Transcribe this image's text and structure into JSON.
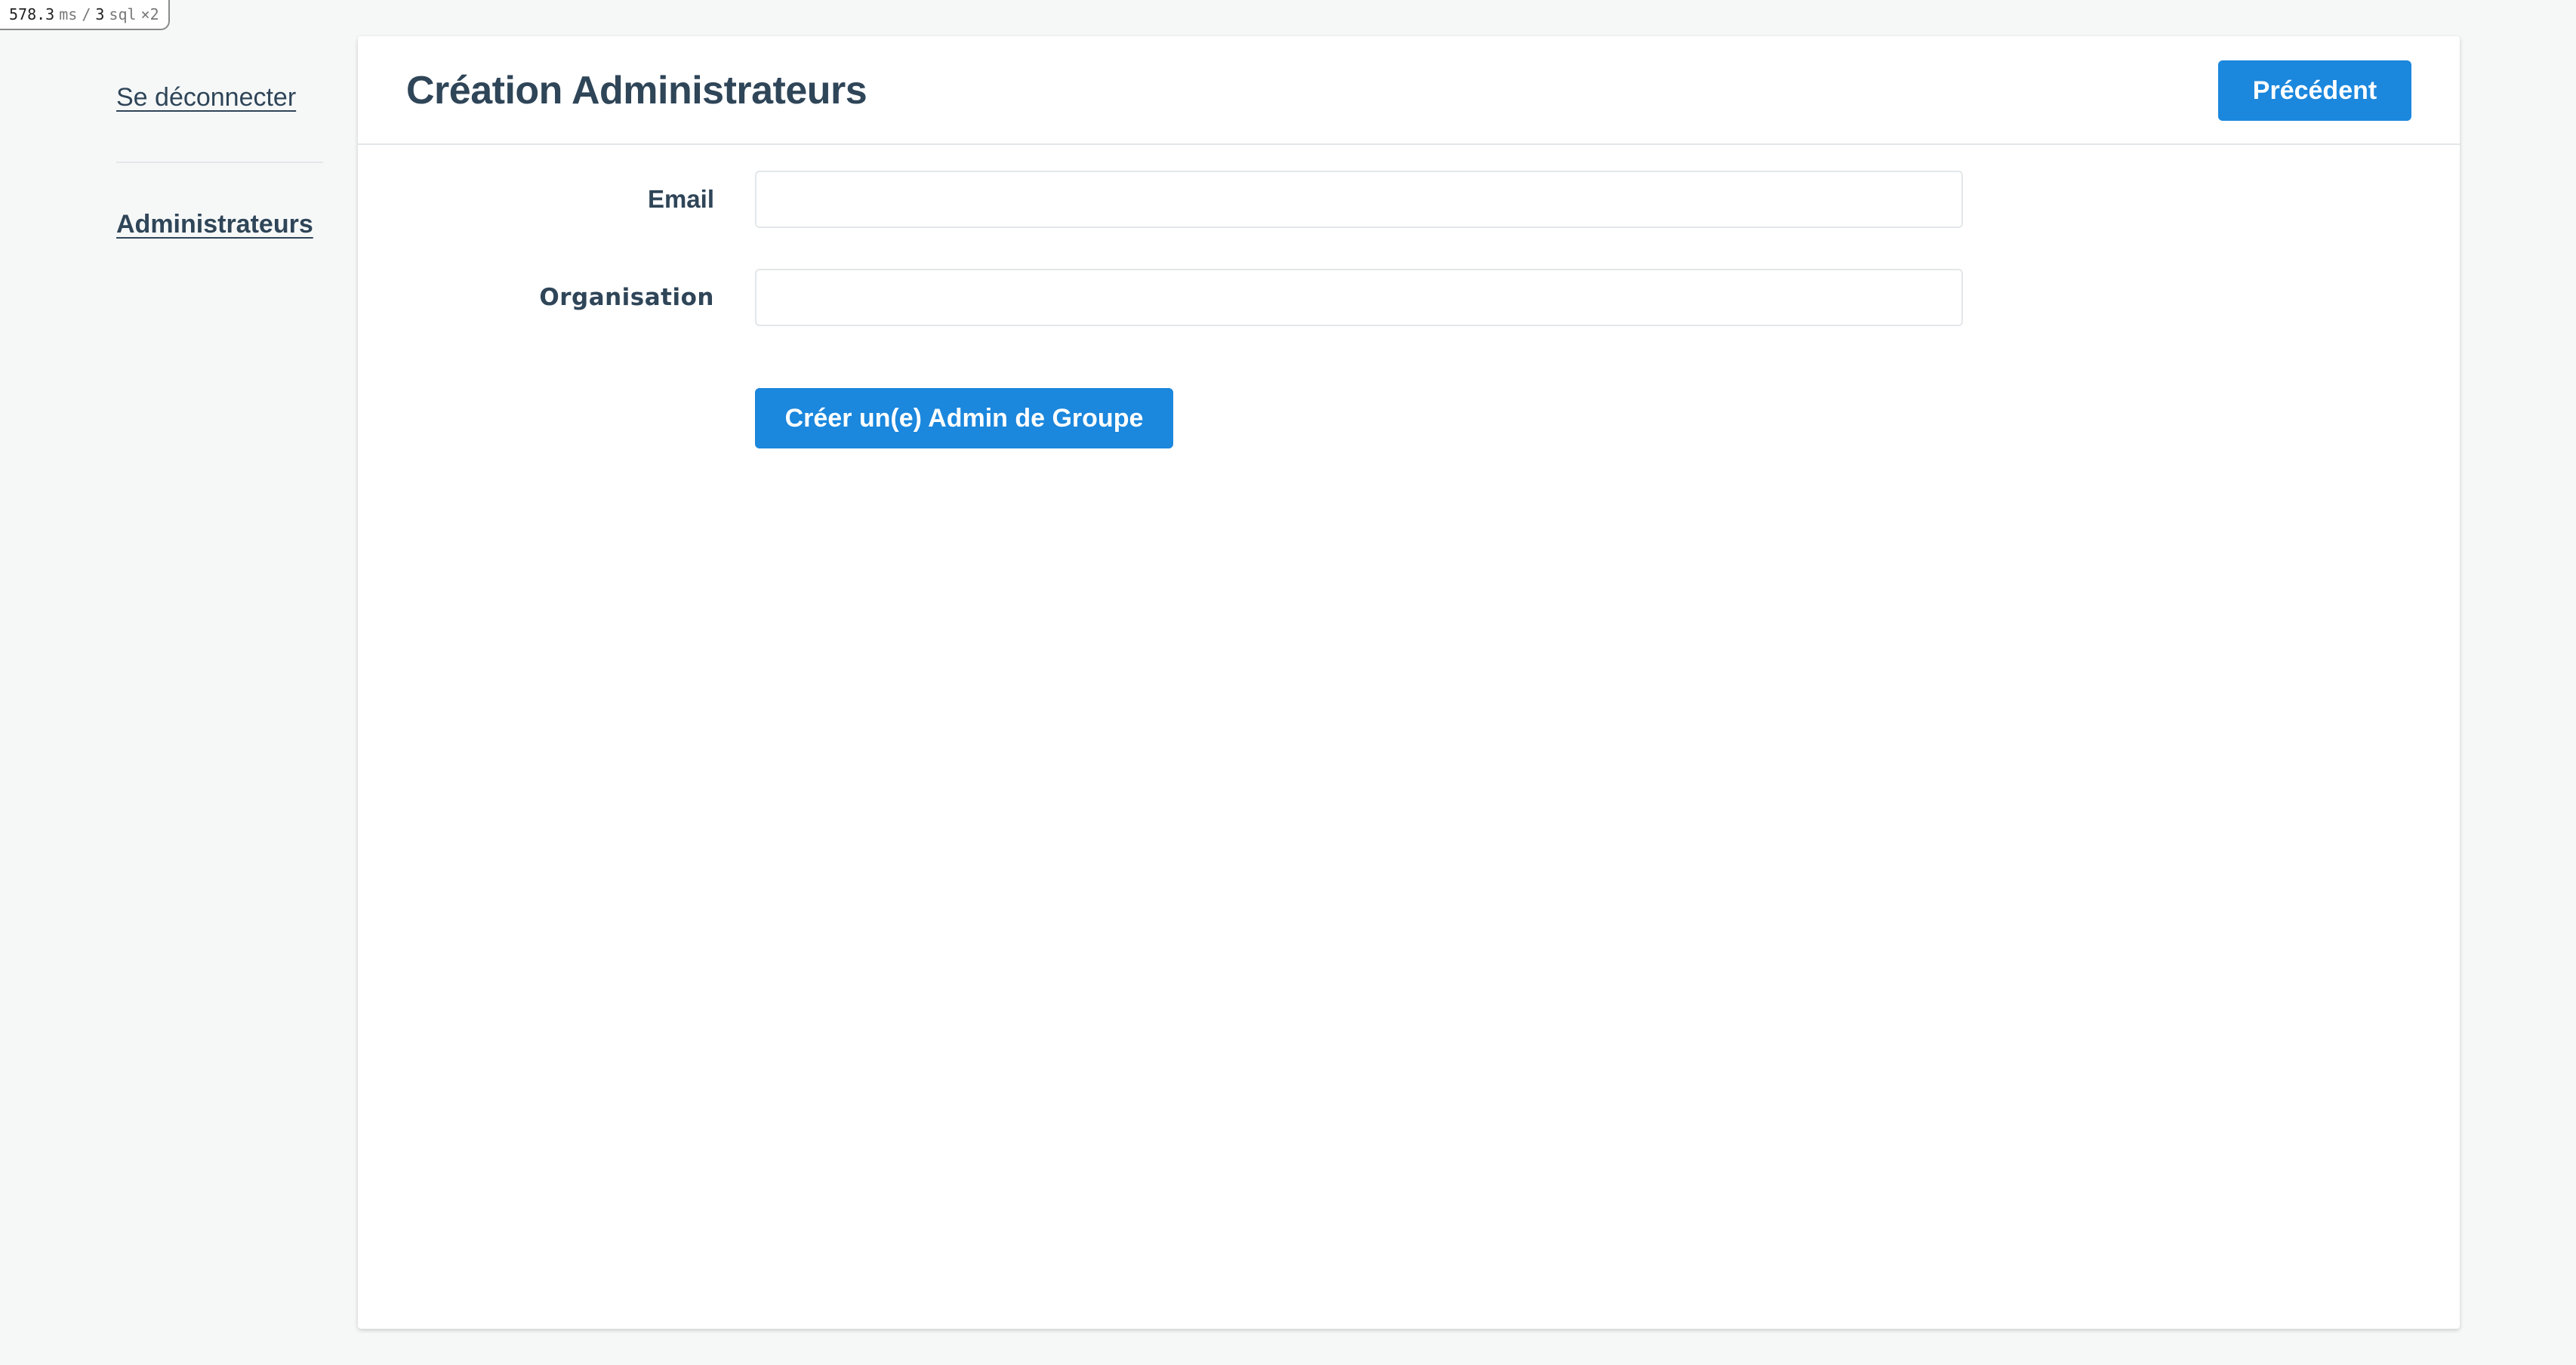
{
  "debug_bar": {
    "time_value": "578.3",
    "time_unit": "ms",
    "separator": "/",
    "sql_count": "3",
    "sql_label": "sql",
    "multiplier": "×2"
  },
  "sidebar": {
    "logout_label": "Se déconnecter",
    "items": [
      {
        "label": "Administrateurs"
      }
    ]
  },
  "header": {
    "title": "Création Administrateurs",
    "back_button_label": "Précédent"
  },
  "form": {
    "email": {
      "label": "Email",
      "value": "",
      "placeholder": ""
    },
    "organisation": {
      "label": "Organisation",
      "value": "",
      "placeholder": ""
    },
    "submit_label": "Créer un(e) Admin de Groupe"
  },
  "colors": {
    "accent": "#1b87dd",
    "text": "#2f4558",
    "background": "#f6f8f8",
    "panel": "#ffffff"
  }
}
